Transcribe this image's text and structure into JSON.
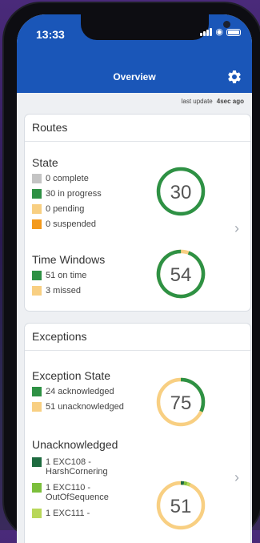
{
  "status_bar": {
    "time": "13:33"
  },
  "header": {
    "title": "Overview"
  },
  "last_update": {
    "label": "last update",
    "value": "4sec ago"
  },
  "routes": {
    "title": "Routes",
    "state": {
      "title": "State",
      "items": [
        {
          "label": "0 complete",
          "color": "#c4c4c4"
        },
        {
          "label": "30 in progress",
          "color": "#2e9144"
        },
        {
          "label": "0 pending",
          "color": "#f8cf82"
        },
        {
          "label": "0 suspended",
          "color": "#f39a1d"
        }
      ],
      "value": "30",
      "ring_color": "#2e9144",
      "ring_fraction": 1
    },
    "time_windows": {
      "title": "Time Windows",
      "items": [
        {
          "label": "51 on time",
          "color": "#2e9144"
        },
        {
          "label": "3 missed",
          "color": "#f8cf82"
        }
      ],
      "value": "54",
      "ring_color": "#2e9144",
      "ring_fraction": 0.944,
      "ring_rest_color": "#f8cf82"
    }
  },
  "exceptions": {
    "title": "Exceptions",
    "state": {
      "title": "Exception State",
      "items": [
        {
          "label": "24 acknowledged",
          "color": "#2e9144"
        },
        {
          "label": "51 unacknowledged",
          "color": "#f8cf82"
        }
      ],
      "value": "75",
      "ring_color": "#2e9144",
      "ring_fraction": 0.32,
      "ring_rest_color": "#f8cf82"
    },
    "unacknowledged": {
      "title": "Unacknowledged",
      "items": [
        {
          "label": "1 EXC108 -\nHarshCornering",
          "color": "#1e6b3f"
        },
        {
          "label": "1 EXC110 -\nOutOfSequence",
          "color": "#7cbf3c"
        },
        {
          "label": "1 EXC111 -",
          "color": "#b8d75a"
        }
      ],
      "value": "51",
      "ring_color": "#f8cf82",
      "ring_accent_colors": [
        "#1e6b3f",
        "#7cbf3c",
        "#b8d75a"
      ]
    }
  }
}
